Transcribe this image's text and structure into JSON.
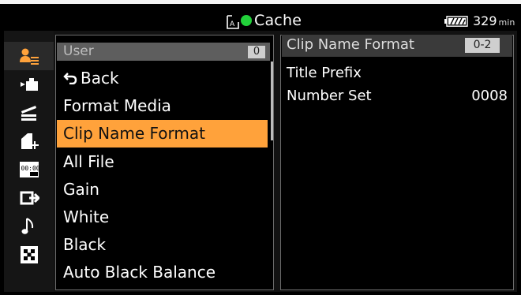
{
  "status": {
    "title": "Cache",
    "battery_time": "329",
    "battery_unit": "min",
    "colors": {
      "recording_dot": "#22d13a",
      "selection": "#ffa23b"
    }
  },
  "sidebar": {
    "icons": [
      {
        "name": "user-icon",
        "selected": true
      },
      {
        "name": "camera-icon",
        "selected": false
      },
      {
        "name": "clapper-icon",
        "selected": false
      },
      {
        "name": "media-card-icon",
        "selected": false
      },
      {
        "name": "timecode-icon",
        "selected": false
      },
      {
        "name": "output-icon",
        "selected": false
      },
      {
        "name": "audio-note-icon",
        "selected": false
      },
      {
        "name": "checker-icon",
        "selected": false
      }
    ]
  },
  "menu": {
    "header": {
      "label": "User",
      "page": "0"
    },
    "items": [
      {
        "label": "Back",
        "selected": false
      },
      {
        "label": "Format Media",
        "selected": false
      },
      {
        "label": "Clip Name Format",
        "selected": true
      },
      {
        "label": "All File",
        "selected": false
      },
      {
        "label": "Gain",
        "selected": false
      },
      {
        "label": "White",
        "selected": false
      },
      {
        "label": "Black",
        "selected": false
      },
      {
        "label": "Auto Black Balance",
        "selected": false
      }
    ]
  },
  "detail": {
    "title": "Clip Name Format",
    "range": "0-2",
    "rows": [
      {
        "label": "Title Prefix",
        "value": ""
      },
      {
        "label": "Number Set",
        "value": "0008"
      }
    ]
  }
}
